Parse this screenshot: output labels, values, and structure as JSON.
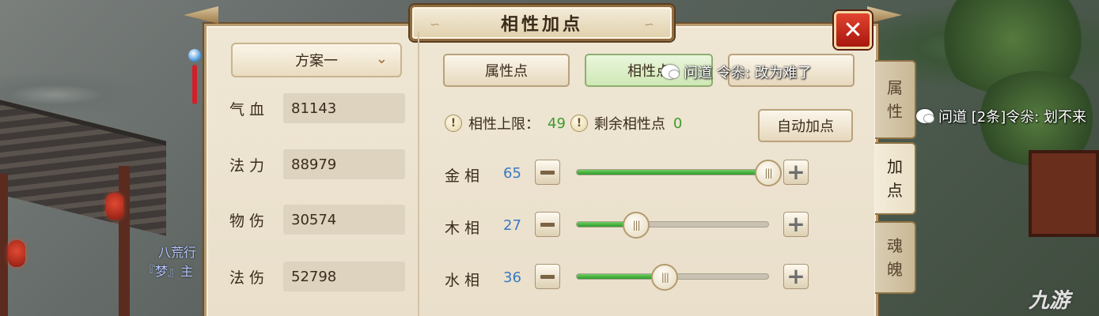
{
  "window": {
    "title": "相性加点",
    "close_label": "✕"
  },
  "scheme": {
    "selected": "方案一"
  },
  "stats": [
    {
      "label": "气血",
      "value": "81143"
    },
    {
      "label": "法力",
      "value": "88979"
    },
    {
      "label": "物伤",
      "value": "30574"
    },
    {
      "label": "法伤",
      "value": "52798"
    }
  ],
  "tabs": [
    {
      "label": "属性点"
    },
    {
      "label": "相性点"
    },
    {
      "label": ""
    }
  ],
  "summary": {
    "limit_label": "相性上限：",
    "limit_value": "49",
    "remaining_label": "剩余相性点",
    "remaining_value": "0",
    "warn_glyph": "!"
  },
  "auto_button": "自动加点",
  "attributes": [
    {
      "name": "金相",
      "value": "65",
      "level": 1.0
    },
    {
      "name": "木相",
      "value": "27",
      "level": 0.31
    },
    {
      "name": "水相",
      "value": "36",
      "level": 0.46
    }
  ],
  "side_tabs": [
    {
      "line1": "属",
      "line2": "性"
    },
    {
      "line1": "加",
      "line2": "点"
    },
    {
      "line1": "魂",
      "line2": "魄"
    }
  ],
  "chat": [
    {
      "text": "问道 令尜: 改为难了"
    },
    {
      "text": "问道 [2条]令尜: 划不来"
    }
  ],
  "background_text": {
    "line1": "八荒行",
    "line2": "『梦』主"
  },
  "watermark": "九游",
  "colors": {
    "accent_green": "#3f9a2f",
    "value_blue": "#3a78c2",
    "close_red": "#c4241a"
  }
}
